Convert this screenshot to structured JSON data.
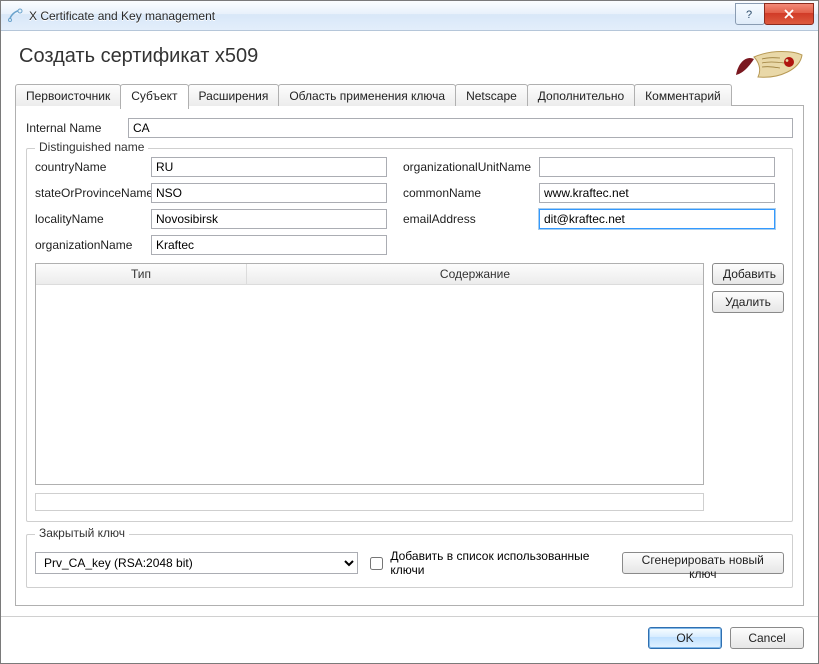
{
  "window": {
    "title": "X Certificate and Key management"
  },
  "page_title": "Создать сертификат x509",
  "tabs": [
    {
      "label": "Первоисточник",
      "active": false
    },
    {
      "label": "Субъект",
      "active": true
    },
    {
      "label": "Расширения",
      "active": false
    },
    {
      "label": "Область применения ключа",
      "active": false
    },
    {
      "label": "Netscape",
      "active": false
    },
    {
      "label": "Дополнительно",
      "active": false
    },
    {
      "label": "Комментарий",
      "active": false
    }
  ],
  "internal_name": {
    "label": "Internal Name",
    "value": "CA"
  },
  "dn": {
    "legend": "Distinguished name",
    "countryName": {
      "label": "countryName",
      "value": "RU"
    },
    "stateOrProvinceName": {
      "label": "stateOrProvinceName",
      "value": "NSO"
    },
    "localityName": {
      "label": "localityName",
      "value": "Novosibirsk"
    },
    "organizationName": {
      "label": "organizationName",
      "value": "Kraftec"
    },
    "organizationalUnitName": {
      "label": "organizationalUnitName",
      "value": ""
    },
    "commonName": {
      "label": "commonName",
      "value": "www.kraftec.net"
    },
    "emailAddress": {
      "label": "emailAddress",
      "value": "dit@kraftec.net"
    }
  },
  "table": {
    "columns": [
      "Тип",
      "Содержание"
    ],
    "rows": []
  },
  "side_buttons": {
    "add": "Добавить",
    "delete": "Удалить"
  },
  "private_key": {
    "legend": "Закрытый ключ",
    "selected": "Prv_CA_key (RSA:2048 bit)",
    "checkbox_label": "Добавить в список использованные ключи",
    "generate_label": "Сгенерировать новый ключ"
  },
  "footer": {
    "ok": "OK",
    "cancel": "Cancel"
  }
}
